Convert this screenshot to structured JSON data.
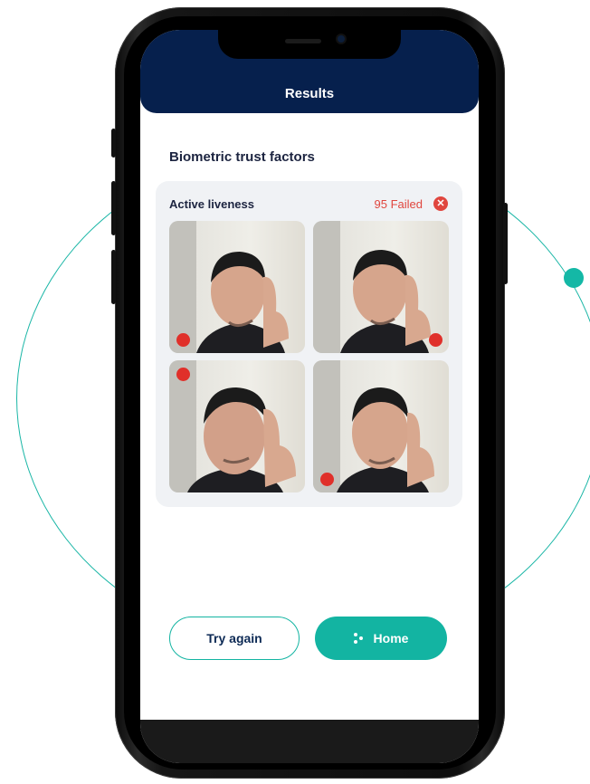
{
  "header": {
    "title": "Results"
  },
  "section": {
    "title": "Biometric trust factors"
  },
  "liveness_card": {
    "label": "Active liveness",
    "status": "95 Failed",
    "status_icon": "close-circle-icon",
    "photos": [
      {
        "name": "photo-1",
        "indicator": "recording-dot"
      },
      {
        "name": "photo-2",
        "indicator": "recording-dot"
      },
      {
        "name": "photo-3",
        "indicator": "recording-dot"
      },
      {
        "name": "photo-4",
        "indicator": "recording-dot"
      }
    ]
  },
  "actions": {
    "try_again_label": "Try again",
    "home_label": "Home",
    "home_icon": "dots-icon"
  },
  "colors": {
    "header_bg": "#06204d",
    "accent": "#13b4a2",
    "fail": "#e0463e"
  }
}
